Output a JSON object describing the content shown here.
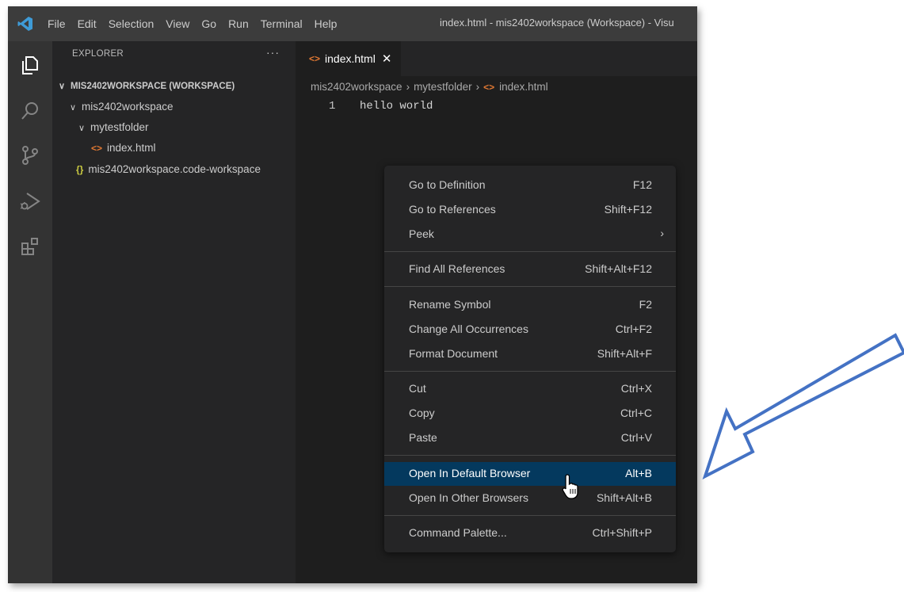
{
  "titlebar": {
    "menu": [
      "File",
      "Edit",
      "Selection",
      "View",
      "Go",
      "Run",
      "Terminal",
      "Help"
    ],
    "window_title": "index.html - mis2402workspace (Workspace) - Visu"
  },
  "activity_bar": [
    "explorer-icon",
    "search-icon",
    "source-control-icon",
    "run-debug-icon",
    "extensions-icon"
  ],
  "sidebar": {
    "title": "EXPLORER",
    "more": "···",
    "tree": {
      "workspace": "MIS2402WORKSPACE (WORKSPACE)",
      "folder": "mis2402workspace",
      "subfolder": "mytestfolder",
      "file": "index.html",
      "workspace_file": "mis2402workspace.code-workspace"
    }
  },
  "editor": {
    "tab_label": "index.html",
    "breadcrumb": [
      "mis2402workspace",
      "mytestfolder",
      "index.html"
    ],
    "line_number": "1",
    "code": "hello world"
  },
  "context_menu": {
    "groups": [
      [
        {
          "label": "Go to Definition",
          "key": "F12"
        },
        {
          "label": "Go to References",
          "key": "Shift+F12"
        },
        {
          "label": "Peek",
          "key": "",
          "submenu": true
        }
      ],
      [
        {
          "label": "Find All References",
          "key": "Shift+Alt+F12"
        }
      ],
      [
        {
          "label": "Rename Symbol",
          "key": "F2"
        },
        {
          "label": "Change All Occurrences",
          "key": "Ctrl+F2"
        },
        {
          "label": "Format Document",
          "key": "Shift+Alt+F"
        }
      ],
      [
        {
          "label": "Cut",
          "key": "Ctrl+X"
        },
        {
          "label": "Copy",
          "key": "Ctrl+C"
        },
        {
          "label": "Paste",
          "key": "Ctrl+V"
        }
      ],
      [
        {
          "label": "Open In Default Browser",
          "key": "Alt+B",
          "highlighted": true
        },
        {
          "label": "Open In Other Browsers",
          "key": "Shift+Alt+B"
        }
      ],
      [
        {
          "label": "Command Palette...",
          "key": "Ctrl+Shift+P"
        }
      ]
    ]
  },
  "colors": {
    "accent": "#04395e",
    "annotation_arrow": "#4472c4",
    "html_icon": "#e37933",
    "json_icon": "#cbcb41"
  }
}
